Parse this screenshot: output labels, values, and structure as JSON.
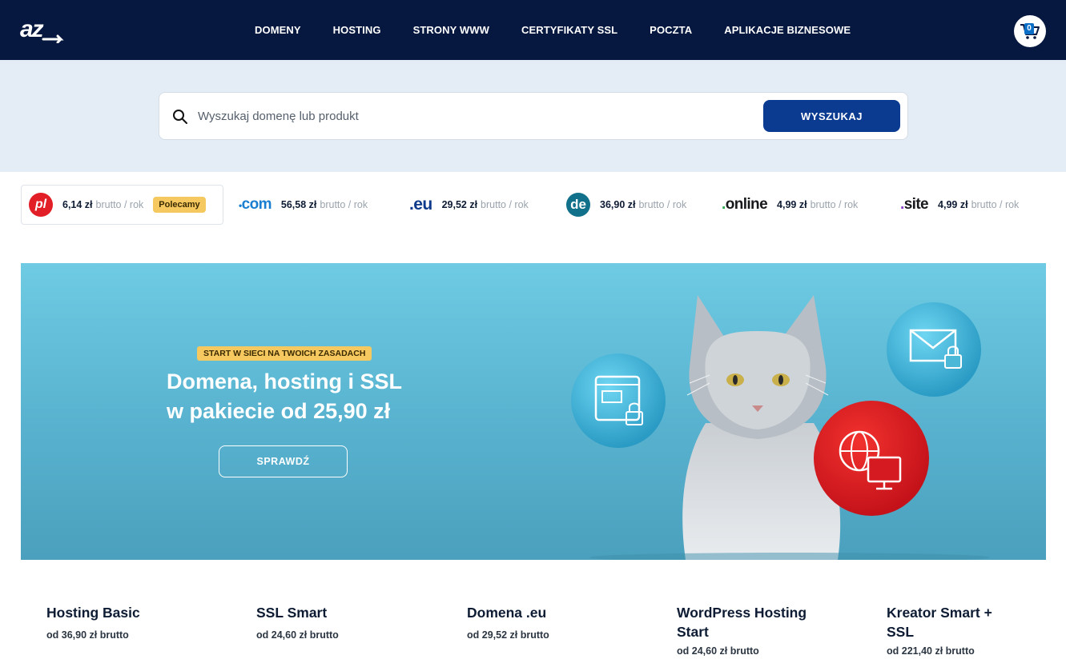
{
  "header": {
    "logo_text": "az",
    "nav": [
      "DOMENY",
      "HOSTING",
      "STRONY WWW",
      "CERTYFIKATY SSL",
      "POCZTA",
      "APLIKACJE BIZNESOWE"
    ],
    "cart_count": "0"
  },
  "search": {
    "placeholder": "Wyszukaj domenę lub produkt",
    "button_label": "WYSZUKAJ"
  },
  "domains": [
    {
      "tld": ".pl",
      "logo_text": "pl",
      "price": "6,14 zł",
      "unit": "brutto / rok",
      "badge": "Polecamy",
      "color": "#e21e26"
    },
    {
      "tld": ".com",
      "logo_text": "com",
      "price": "56,58 zł",
      "unit": "brutto / rok",
      "color": "#1b7fd1"
    },
    {
      "tld": ".eu",
      "logo_text": "eu",
      "price": "29,52 zł",
      "unit": "brutto / rok",
      "color": "#0d3a8a"
    },
    {
      "tld": ".de",
      "logo_text": "de",
      "price": "36,90 zł",
      "unit": "brutto / rok",
      "color": "#11708a"
    },
    {
      "tld": ".online",
      "logo_text": "online",
      "price": "4,99 zł",
      "unit": "brutto / rok",
      "color": "#17191c"
    },
    {
      "tld": ".site",
      "logo_text": "site",
      "price": "4,99 zł",
      "unit": "brutto / rok",
      "color": "#17191c"
    }
  ],
  "banner": {
    "tag": "START W SIECI NA TWOICH ZASADACH",
    "title": "Domena, hosting i SSL w pakiecie od 25,90 zł",
    "button_label": "SPRAWDŹ"
  },
  "products": [
    {
      "name": "Hosting Basic",
      "price": "od 36,90 zł brutto"
    },
    {
      "name": "SSL Smart",
      "price": "od 24,60 zł brutto"
    },
    {
      "name": "Domena .eu",
      "price": "od 29,52 zł brutto"
    },
    {
      "name": "WordPress Hosting Start",
      "price": "od 24,60 zł brutto"
    },
    {
      "name": "Kreator Smart + SSL",
      "price": "od 221,40 zł brutto"
    }
  ],
  "colors": {
    "header_bg": "#06183f",
    "search_bg": "#e4edf5",
    "primary_button": "#0b3b91",
    "badge": "#f6c860",
    "banner": "#5bb7d3",
    "accent_red": "#e21e26"
  }
}
